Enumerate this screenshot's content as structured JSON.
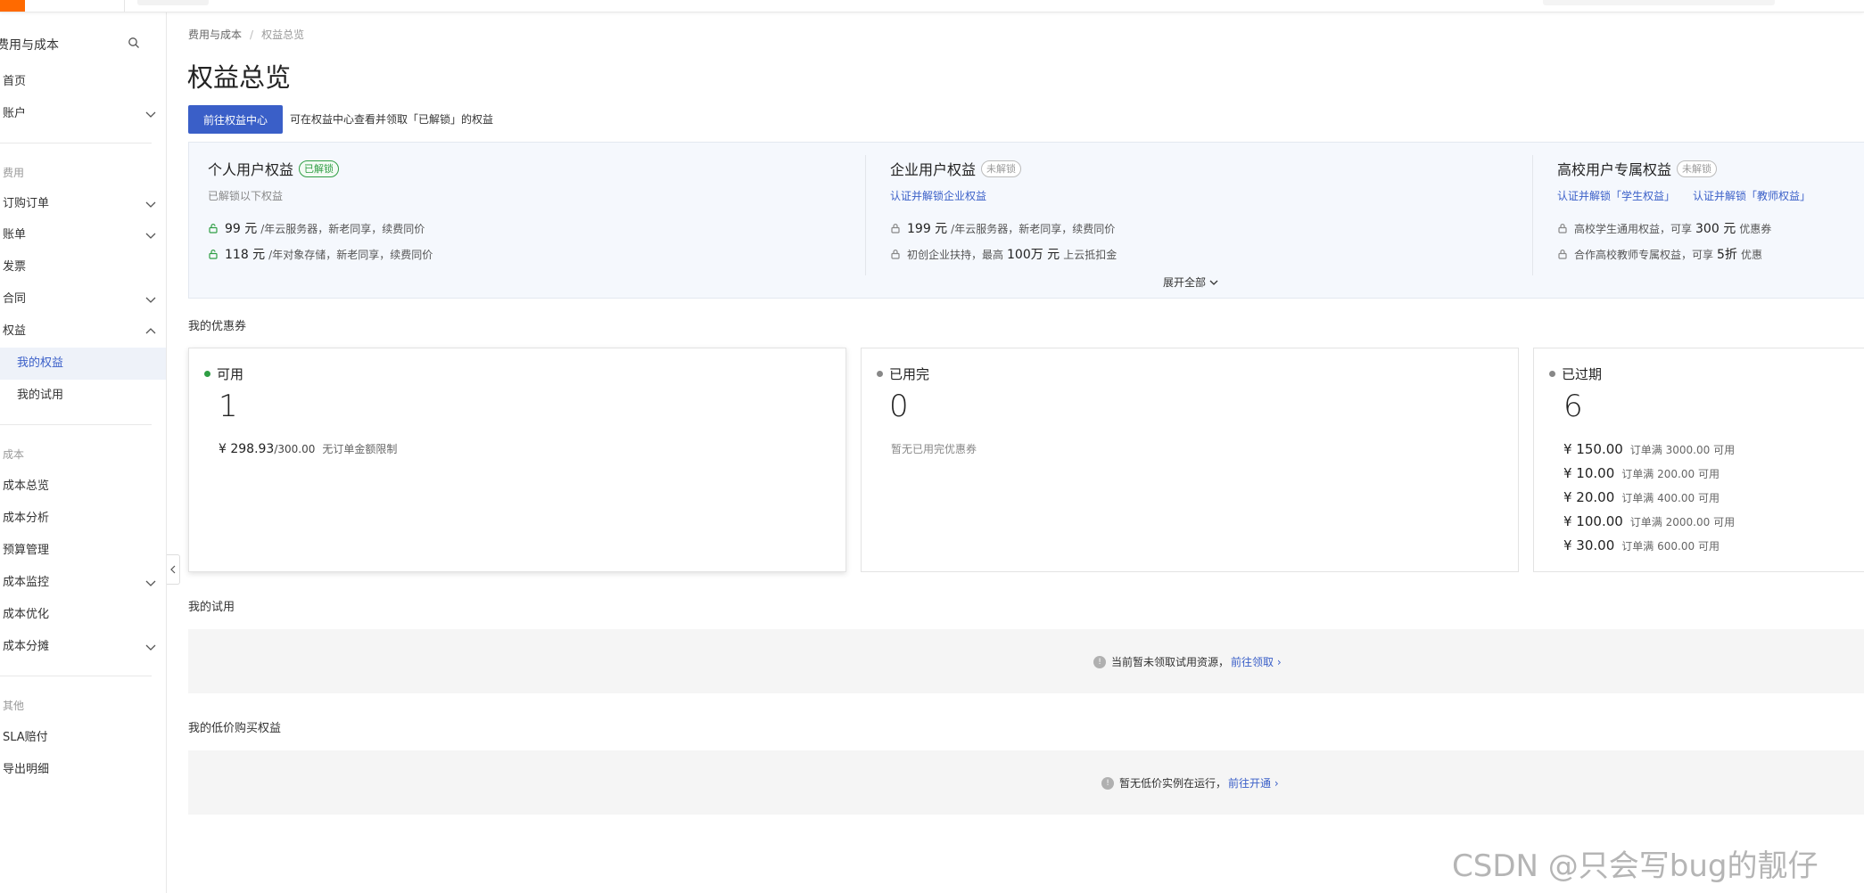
{
  "sidebar": {
    "title": "费用与成本",
    "items": [
      {
        "label": "首页"
      },
      {
        "label": "账户"
      },
      {
        "label": "费用"
      },
      {
        "label": "订购订单"
      },
      {
        "label": "账单"
      },
      {
        "label": "发票"
      },
      {
        "label": "合同"
      },
      {
        "label": "权益"
      },
      {
        "label": "我的权益"
      },
      {
        "label": "我的试用"
      },
      {
        "label": "成本"
      },
      {
        "label": "成本总览"
      },
      {
        "label": "成本分析"
      },
      {
        "label": "预算管理"
      },
      {
        "label": "成本监控"
      },
      {
        "label": "成本优化"
      },
      {
        "label": "成本分摊"
      },
      {
        "label": "其他"
      },
      {
        "label": "SLA赔付"
      },
      {
        "label": "导出明细"
      }
    ]
  },
  "breadcrumb": {
    "parent": "费用与成本",
    "separator": "/",
    "current": "权益总览"
  },
  "page_title": "权益总览",
  "primary_button": "前往权益中心",
  "primary_hint": "可在权益中心查看并领取「已解锁」的权益",
  "benefits": {
    "personal": {
      "title": "个人用户权益",
      "tag": "已解锁",
      "sub": "已解锁以下权益",
      "lines": [
        {
          "amount": "99 元",
          "text": "/年云服务器，新老同享，续费同价"
        },
        {
          "amount": "118 元",
          "text": "/年对象存储，新老同享，续费同价"
        }
      ]
    },
    "enterprise": {
      "title": "企业用户权益",
      "tag": "未解锁",
      "sub": "认证并解锁企业权益",
      "line1_amount": "199 元",
      "line1_text": "/年云服务器，新老同享，续费同价",
      "line2_pre": "初创企业扶持，最高",
      "line2_amount": "100万 元",
      "line2_post": "上云抵扣金"
    },
    "university": {
      "title": "高校用户专属权益",
      "tag": "未解锁",
      "sub_link1": "认证并解锁「学生权益」",
      "sub_link2": "认证并解锁「教师权益」",
      "line1_pre": "高校学生通用权益，可享",
      "line1_amount": "300 元",
      "line1_post": "优惠券",
      "line2_pre": "合作高校教师专属权益，可享",
      "line2_amount": "5折",
      "line2_post": "优惠"
    },
    "expand_all": "展开全部"
  },
  "coupons": {
    "section_title": "我的优惠券",
    "available": {
      "status": "可用",
      "count": "1",
      "amount": "¥ 298.93",
      "total": "/300.00",
      "note": "无订单金额限制"
    },
    "used": {
      "status": "已用完",
      "count": "0",
      "note": "暂无已用完优惠券"
    },
    "expired": {
      "status": "已过期",
      "count": "6",
      "items": [
        {
          "amount": "¥ 150.00",
          "cond": "订单满",
          "min": "3000.00",
          "suffix": "可用"
        },
        {
          "amount": "¥ 10.00",
          "cond": "订单满",
          "min": "200.00",
          "suffix": "可用"
        },
        {
          "amount": "¥ 20.00",
          "cond": "订单满",
          "min": "400.00",
          "suffix": "可用"
        },
        {
          "amount": "¥ 100.00",
          "cond": "订单满",
          "min": "2000.00",
          "suffix": "可用"
        },
        {
          "amount": "¥ 30.00",
          "cond": "订单满",
          "min": "600.00",
          "suffix": "可用"
        }
      ]
    }
  },
  "trials": {
    "section_title": "我的试用",
    "empty_text": "当前暂未领取试用资源，",
    "link": "前往领取"
  },
  "lowprice": {
    "section_title": "我的低价购买权益",
    "empty_text": "暂无低价实例在运行，",
    "link": "前往开通"
  },
  "watermark": "CSDN @只会写bug的靓仔",
  "colors": {
    "primary": "#3a5fc8",
    "unlocked": "#2f9e44",
    "available_dot": "#2f9e44",
    "muted_dot": "#888888"
  }
}
